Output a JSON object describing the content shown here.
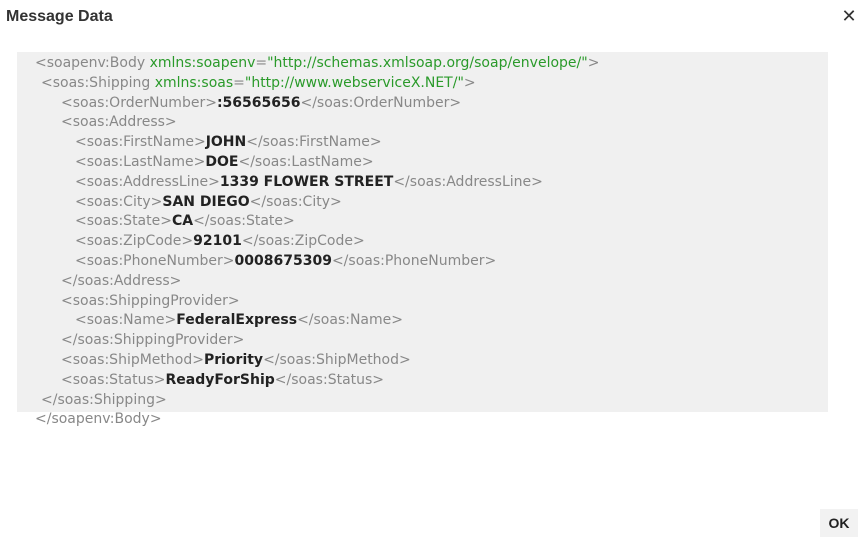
{
  "dialog": {
    "title": "Message Data",
    "close_glyph": "✕",
    "close_icon": "close-icon",
    "ok_label": "OK"
  },
  "xml_lines": [
    {
      "indent": 0,
      "parts": [
        {
          "t": "tag",
          "v": "<soapenv:Body "
        },
        {
          "t": "attr",
          "v": "xmlns:soapenv"
        },
        {
          "t": "tag",
          "v": "="
        },
        {
          "t": "attr",
          "v": "\"http://schemas.xmlsoap.org/soap/envelope/\""
        },
        {
          "t": "tag",
          "v": ">"
        }
      ]
    },
    {
      "indent": 1,
      "parts": [
        {
          "t": "tag",
          "v": "<soas:Shipping "
        },
        {
          "t": "attr",
          "v": "xmlns:soas"
        },
        {
          "t": "tag",
          "v": "="
        },
        {
          "t": "attr",
          "v": "\"http://www.webserviceX.NET/\""
        },
        {
          "t": "tag",
          "v": ">"
        }
      ]
    },
    {
      "indent": 2,
      "parts": [
        {
          "t": "tag",
          "v": "<soas:OrderNumber>"
        },
        {
          "t": "val",
          "v": ":56565656"
        },
        {
          "t": "tag",
          "v": "</soas:OrderNumber>"
        }
      ]
    },
    {
      "indent": 2,
      "parts": [
        {
          "t": "tag",
          "v": "<soas:Address>"
        }
      ]
    },
    {
      "indent": 3,
      "parts": [
        {
          "t": "tag",
          "v": "<soas:FirstName>"
        },
        {
          "t": "val",
          "v": "JOHN"
        },
        {
          "t": "tag",
          "v": "</soas:FirstName>"
        }
      ]
    },
    {
      "indent": 3,
      "parts": [
        {
          "t": "tag",
          "v": "<soas:LastName>"
        },
        {
          "t": "val",
          "v": "DOE"
        },
        {
          "t": "tag",
          "v": "</soas:LastName>"
        }
      ]
    },
    {
      "indent": 3,
      "parts": [
        {
          "t": "tag",
          "v": "<soas:AddressLine>"
        },
        {
          "t": "val",
          "v": "1339 FLOWER STREET"
        },
        {
          "t": "tag",
          "v": "</soas:AddressLine>"
        }
      ]
    },
    {
      "indent": 3,
      "parts": [
        {
          "t": "tag",
          "v": "<soas:City>"
        },
        {
          "t": "val",
          "v": "SAN DIEGO"
        },
        {
          "t": "tag",
          "v": "</soas:City>"
        }
      ]
    },
    {
      "indent": 3,
      "parts": [
        {
          "t": "tag",
          "v": "<soas:State>"
        },
        {
          "t": "val",
          "v": "CA"
        },
        {
          "t": "tag",
          "v": "</soas:State>"
        }
      ]
    },
    {
      "indent": 3,
      "parts": [
        {
          "t": "tag",
          "v": "<soas:ZipCode>"
        },
        {
          "t": "val",
          "v": "92101"
        },
        {
          "t": "tag",
          "v": "</soas:ZipCode>"
        }
      ]
    },
    {
      "indent": 3,
      "parts": [
        {
          "t": "tag",
          "v": "<soas:PhoneNumber>"
        },
        {
          "t": "val",
          "v": "0008675309"
        },
        {
          "t": "tag",
          "v": "</soas:PhoneNumber>"
        }
      ]
    },
    {
      "indent": 2,
      "parts": [
        {
          "t": "tag",
          "v": "</soas:Address>"
        }
      ]
    },
    {
      "indent": 2,
      "parts": [
        {
          "t": "tag",
          "v": "<soas:ShippingProvider>"
        }
      ]
    },
    {
      "indent": 3,
      "parts": [
        {
          "t": "tag",
          "v": "<soas:Name>"
        },
        {
          "t": "val",
          "v": "FederalExpress"
        },
        {
          "t": "tag",
          "v": "</soas:Name>"
        }
      ]
    },
    {
      "indent": 2,
      "parts": [
        {
          "t": "tag",
          "v": "</soas:ShippingProvider>"
        }
      ]
    },
    {
      "indent": 2,
      "parts": [
        {
          "t": "tag",
          "v": "<soas:ShipMethod>"
        },
        {
          "t": "val",
          "v": "Priority"
        },
        {
          "t": "tag",
          "v": "</soas:ShipMethod>"
        }
      ]
    },
    {
      "indent": 2,
      "parts": [
        {
          "t": "tag",
          "v": "<soas:Status>"
        },
        {
          "t": "val",
          "v": "ReadyForShip"
        },
        {
          "t": "tag",
          "v": "</soas:Status>"
        }
      ]
    },
    {
      "indent": 1,
      "parts": [
        {
          "t": "tag",
          "v": "</soas:Shipping>"
        }
      ]
    },
    {
      "indent": 0,
      "parts": [
        {
          "t": "tag",
          "v": "</soapenv:Body>"
        }
      ]
    }
  ],
  "colors": {
    "tag": "#888888",
    "attr": "#2a9a2a",
    "value": "#222222",
    "panel_bg": "#f0f0f0"
  }
}
